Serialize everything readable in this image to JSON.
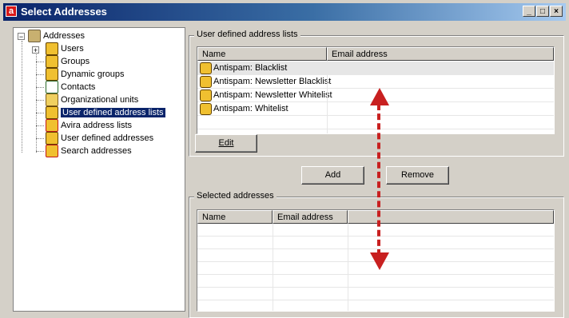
{
  "window": {
    "title": "Select Addresses",
    "app_icon": "avira-umbrella-icon",
    "buttons": [
      "_",
      "□",
      "×"
    ]
  },
  "tree": {
    "root_label": "Addresses",
    "items": [
      {
        "label": "Users",
        "icon": "users-icon"
      },
      {
        "label": "Groups",
        "icon": "group-icon"
      },
      {
        "label": "Dynamic groups",
        "icon": "dynamic-group-icon"
      },
      {
        "label": "Contacts",
        "icon": "contacts-icon"
      },
      {
        "label": "Organizational units",
        "icon": "org-units-icon"
      },
      {
        "label": "User defined address lists",
        "icon": "address-list-icon",
        "selected": true
      },
      {
        "label": "Avira address lists",
        "icon": "avira-list-icon"
      },
      {
        "label": "User defined addresses",
        "icon": "user-address-icon"
      },
      {
        "label": "Search addresses",
        "icon": "search-address-icon"
      }
    ]
  },
  "user_lists": {
    "group_label": "User defined address lists",
    "columns": [
      "Name",
      "Email address"
    ],
    "rows": [
      {
        "name": "Antispam: Blacklist",
        "email": ""
      },
      {
        "name": "Antispam: Newsletter Blacklist",
        "email": ""
      },
      {
        "name": "Antispam: Newsletter Whitelist",
        "email": ""
      },
      {
        "name": "Antispam: Whitelist",
        "email": ""
      }
    ],
    "edit_label": "Edit"
  },
  "actions": {
    "add_label": "Add",
    "remove_label": "Remove"
  },
  "selected": {
    "group_label": "Selected addresses",
    "columns": [
      "Name",
      "Email address"
    ],
    "rows": []
  },
  "colors": {
    "selection": "#0a246a",
    "arrow": "#c82020"
  }
}
